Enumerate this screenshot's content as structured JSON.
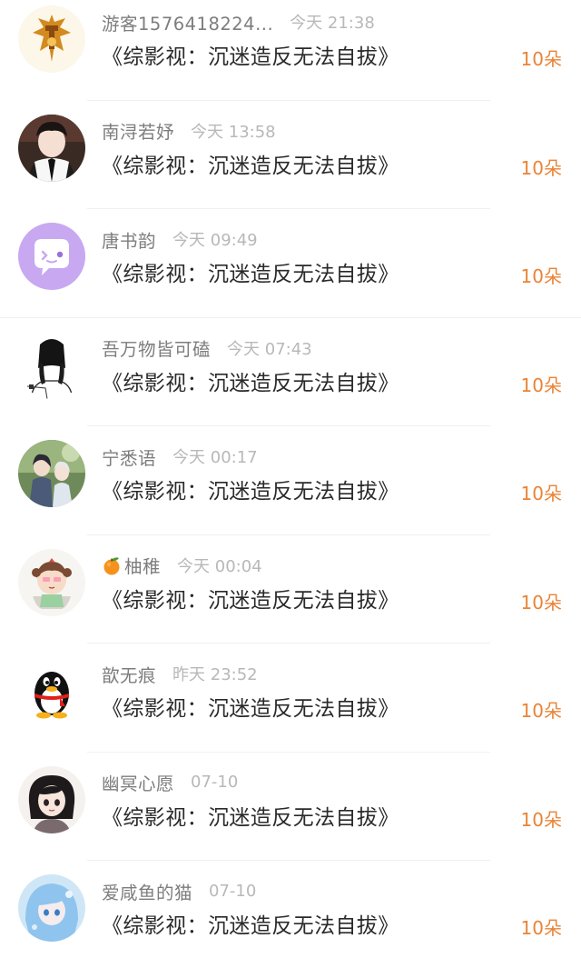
{
  "colors": {
    "username": "#7d7d7d",
    "time": "#b8b8b8",
    "book_title": "#2a2a2a",
    "gift": "#e98437",
    "divider": "#f0f0f0"
  },
  "items": [
    {
      "username": "游客1576418224...",
      "time": "今天 21:38",
      "book": "《综影视：沉迷造反无法自拔》",
      "gift": "10朵",
      "avatar_icon": "golden-emblem-avatar-icon"
    },
    {
      "username": "南浔若妤",
      "time": "今天 13:58",
      "book": "《综影视：沉迷造反无法自拔》",
      "gift": "10朵",
      "avatar_icon": "boy-portrait-avatar-icon"
    },
    {
      "username": "唐书韵",
      "time": "今天 09:49",
      "book": "《综影视：沉迷造反无法自拔》",
      "gift": "10朵",
      "avatar_icon": "purple-chat-bubble-avatar-icon"
    },
    {
      "username": "吾万物皆可磕",
      "time": "今天 07:43",
      "book": "《综影视：沉迷造反无法自拔》",
      "gift": "10朵",
      "avatar_icon": "braided-girl-sketch-avatar-icon"
    },
    {
      "username": "宁悉语",
      "time": "今天 00:17",
      "book": "《综影视：沉迷造反无法自拔》",
      "gift": "10朵",
      "avatar_icon": "two-characters-avatar-icon"
    },
    {
      "username": "柚稚",
      "time": "今天 00:04",
      "book": "《综影视：沉迷造反无法自拔》",
      "gift": "10朵",
      "avatar_icon": "cartoon-girl-avatar-icon",
      "prefix_icon": "tangerine-emoji-icon"
    },
    {
      "username": "歆无痕",
      "time": "昨天 23:52",
      "book": "《综影视：沉迷造反无法自拔》",
      "gift": "10朵",
      "avatar_icon": "qq-penguin-avatar-icon"
    },
    {
      "username": "幽冥心愿",
      "time": "07-10",
      "book": "《综影视：沉迷造反无法自拔》",
      "gift": "10朵",
      "avatar_icon": "anime-girl-avatar-icon"
    },
    {
      "username": "爱咸鱼的猫",
      "time": "07-10",
      "book": "《综影视：沉迷造反无法自拔》",
      "gift": "10朵",
      "avatar_icon": "blue-anime-avatar-icon"
    }
  ]
}
